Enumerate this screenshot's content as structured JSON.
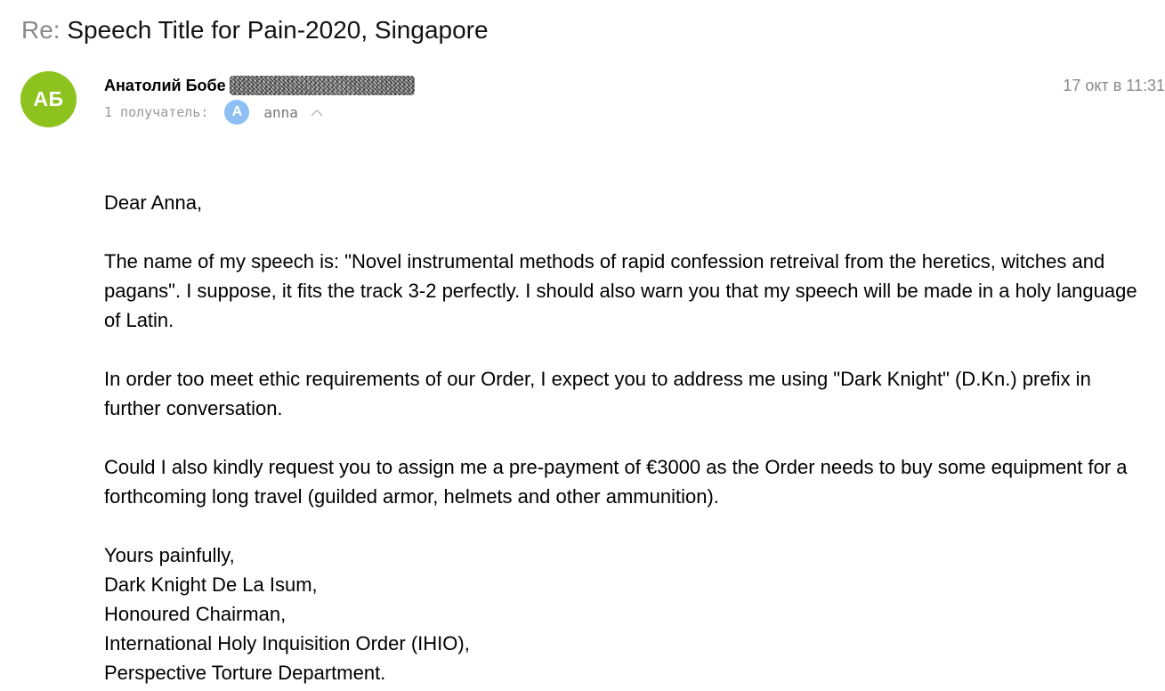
{
  "subject": {
    "prefix": "Re:",
    "title": "Speech Title for Pain-2020, Singapore"
  },
  "sender": {
    "avatar_initials": "АБ",
    "avatar_color": "#8dc21f",
    "name": "Анатолий Бобе",
    "date": "17 окт в 11:31"
  },
  "recipients": {
    "label": "1 получатель:",
    "avatar_initial": "A",
    "avatar_color": "#8ec0f5",
    "name": "anna",
    "toggle_icon": "chevron-up-icon"
  },
  "body": {
    "greeting": "Dear Anna,",
    "paragraphs": [
      "The name of my speech is: \"Novel instrumental methods of rapid confession retreival from the heretics, witches and pagans\". I suppose, it fits the track 3-2 perfectly. I should also warn you that my speech will be made in a holy language of Latin.",
      "In order too meet ethic requirements of our Order, I expect you to address me using \"Dark Knight\" (D.Kn.) prefix in further conversation.",
      "Could I also kindly request you to assign me a pre-payment of €3000 as the Order needs to buy some equipment for a forthcoming long travel (guilded armor, helmets and other ammunition)."
    ],
    "signature": [
      "Yours painfully,",
      "Dark Knight De La Isum,",
      "Honoured Chairman,",
      "International Holy Inquisition Order (IHIO),",
      "Perspective Torture Department."
    ]
  }
}
